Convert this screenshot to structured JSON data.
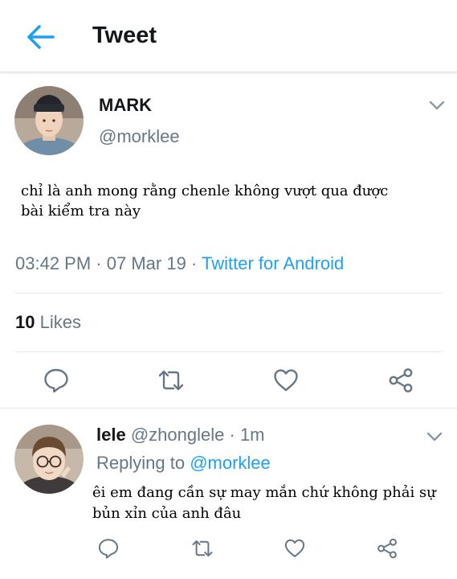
{
  "header": {
    "title": "Tweet",
    "back_icon": "arrow-left-icon",
    "accent": "#1da1f2"
  },
  "tweet": {
    "display_name": "MARK",
    "handle": "@morklee",
    "text": "chỉ là anh mong rằng chenle không vượt qua được bài kiểm tra này",
    "time": "03:42 PM",
    "date": "07 Mar 19",
    "source": "Twitter for Android",
    "likes_count": "10",
    "likes_label": "Likes",
    "actions": [
      "reply-icon",
      "retweet-icon",
      "like-icon",
      "share-icon"
    ]
  },
  "reply": {
    "display_name": "lele",
    "handle": "@zhonglele",
    "age": "1m",
    "replying_label": "Replying to",
    "replying_to": "@morklee",
    "text": "êi em đang cần sự may mắn chứ không phải sự bủn xỉn của anh đâu"
  },
  "colors": {
    "muted": "#657786",
    "text": "#14171a",
    "link": "#1da1f2",
    "divider": "#e1e8ed"
  }
}
